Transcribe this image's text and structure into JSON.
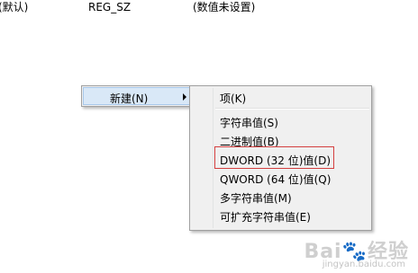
{
  "registry_row": {
    "name": "(默认)",
    "type": "REG_SZ",
    "data": "(数值未设置)"
  },
  "context_menu": {
    "new_label": "新建(N)",
    "arrow_icon": "chevron-right-icon"
  },
  "submenu": {
    "items": [
      {
        "label": "项(K)"
      },
      {
        "label": "字符串值(S)"
      },
      {
        "label": "二进制值(B)"
      },
      {
        "label": "DWORD (32 位)值(D)"
      },
      {
        "label": "QWORD (64 位)值(Q)"
      },
      {
        "label": "多字符串值(M)"
      },
      {
        "label": "可扩充字符串值(E)"
      }
    ]
  },
  "highlight_color": "#d43f3f",
  "watermark": {
    "logo": "Bai🐾经验",
    "url": "jingyan.baidu.com"
  }
}
